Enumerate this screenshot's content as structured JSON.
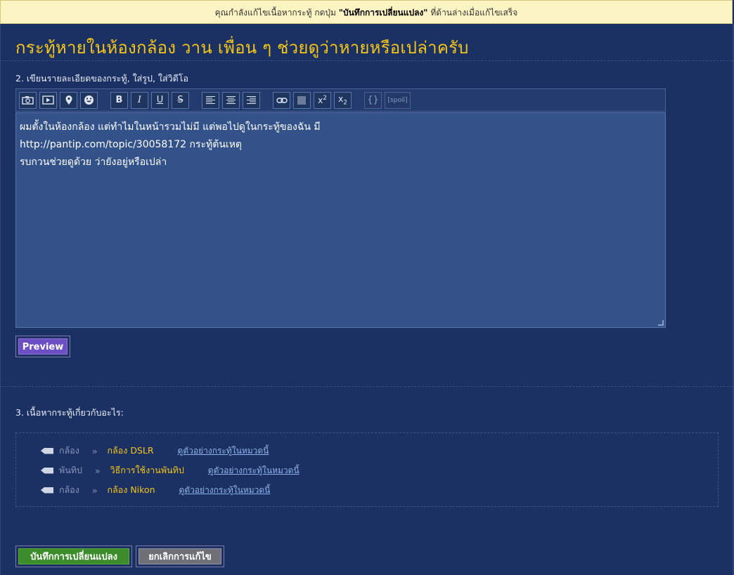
{
  "notice": {
    "prefix": "คุณกำลังแก้ไขเนื้อหากระทู้ กดปุ่ม ",
    "button_ref": "\"บันทึกการเปลี่ยนแปลง\"",
    "suffix": " ที่ด้านล่างเมื่อแก้ไขเสร็จ"
  },
  "title": "กระทู้หายในห้องกล้อง วาน เพื่อน ๆ ช่วยดูว่าหายหรือเปล่าครับ",
  "section2_label": "2. เขียนรายละเอียดของกระทู้, ใส่รูป, ใส่วิดีโอ",
  "toolbar": {
    "buttons": [
      {
        "name": "camera-icon",
        "glyph": "📷"
      },
      {
        "name": "video-icon",
        "glyph": "▶"
      },
      {
        "name": "map-pin-icon",
        "glyph": "📍"
      },
      {
        "name": "emoticon-icon",
        "glyph": "☻"
      },
      {
        "name": "bold-button",
        "glyph": "B"
      },
      {
        "name": "italic-button",
        "glyph": "I"
      },
      {
        "name": "underline-button",
        "glyph": "U"
      },
      {
        "name": "strikethrough-button",
        "glyph": "S"
      },
      {
        "name": "align-left-icon",
        "glyph": "≡"
      },
      {
        "name": "align-center-icon",
        "glyph": "≡"
      },
      {
        "name": "align-right-icon",
        "glyph": "≡"
      },
      {
        "name": "link-icon",
        "glyph": "⊂⊃"
      },
      {
        "name": "barcode-icon",
        "glyph": "|||"
      },
      {
        "name": "superscript-button",
        "glyph": "x²"
      },
      {
        "name": "subscript-button",
        "glyph": "x₂"
      },
      {
        "name": "code-button",
        "glyph": "{}"
      },
      {
        "name": "spoil-button",
        "glyph": "[spoil]"
      }
    ]
  },
  "editor": {
    "lines": [
      "ผมตั้งในห้องกล้อง แต่ทำไมในหน้ารวมไม่มี แต่พอไปดูในกระทู้ของฉัน มี",
      "http://pantip.com/topic/30058172 กระทู้ต้นเหตุ",
      "รบกวนช่วยดูด้วย ว่ายังอยู่หรือเปล่า"
    ]
  },
  "preview_label": "Preview",
  "section3_label": "3. เนื้อหากระทู้เกี่ยวกับอะไร:",
  "topics": [
    {
      "category": "กล้อง",
      "sub": "กล้อง DSLR",
      "link": "ดูตัวอย่างกระทู้ในหมวดนี้"
    },
    {
      "category": "พันทิป",
      "sub": "วิธีการใช้งานพันทิป",
      "link": "ดูตัวอย่างกระทู้ในหมวดนี้"
    },
    {
      "category": "กล้อง",
      "sub": "กล้อง Nikon",
      "link": "ดูตัวอย่างกระทู้ในหมวดนี้"
    }
  ],
  "arrow": "»",
  "save_label": "บันทึกการเปลี่ยนแปลง",
  "cancel_label": "ยกเลิกการแก้ไข",
  "colors": {
    "background": "#1c3163",
    "title": "#f5c518",
    "notice_bg": "#fdf4c4",
    "preview": "#6d4fc4",
    "save": "#3c8c2c",
    "cancel": "#6f6f78"
  }
}
